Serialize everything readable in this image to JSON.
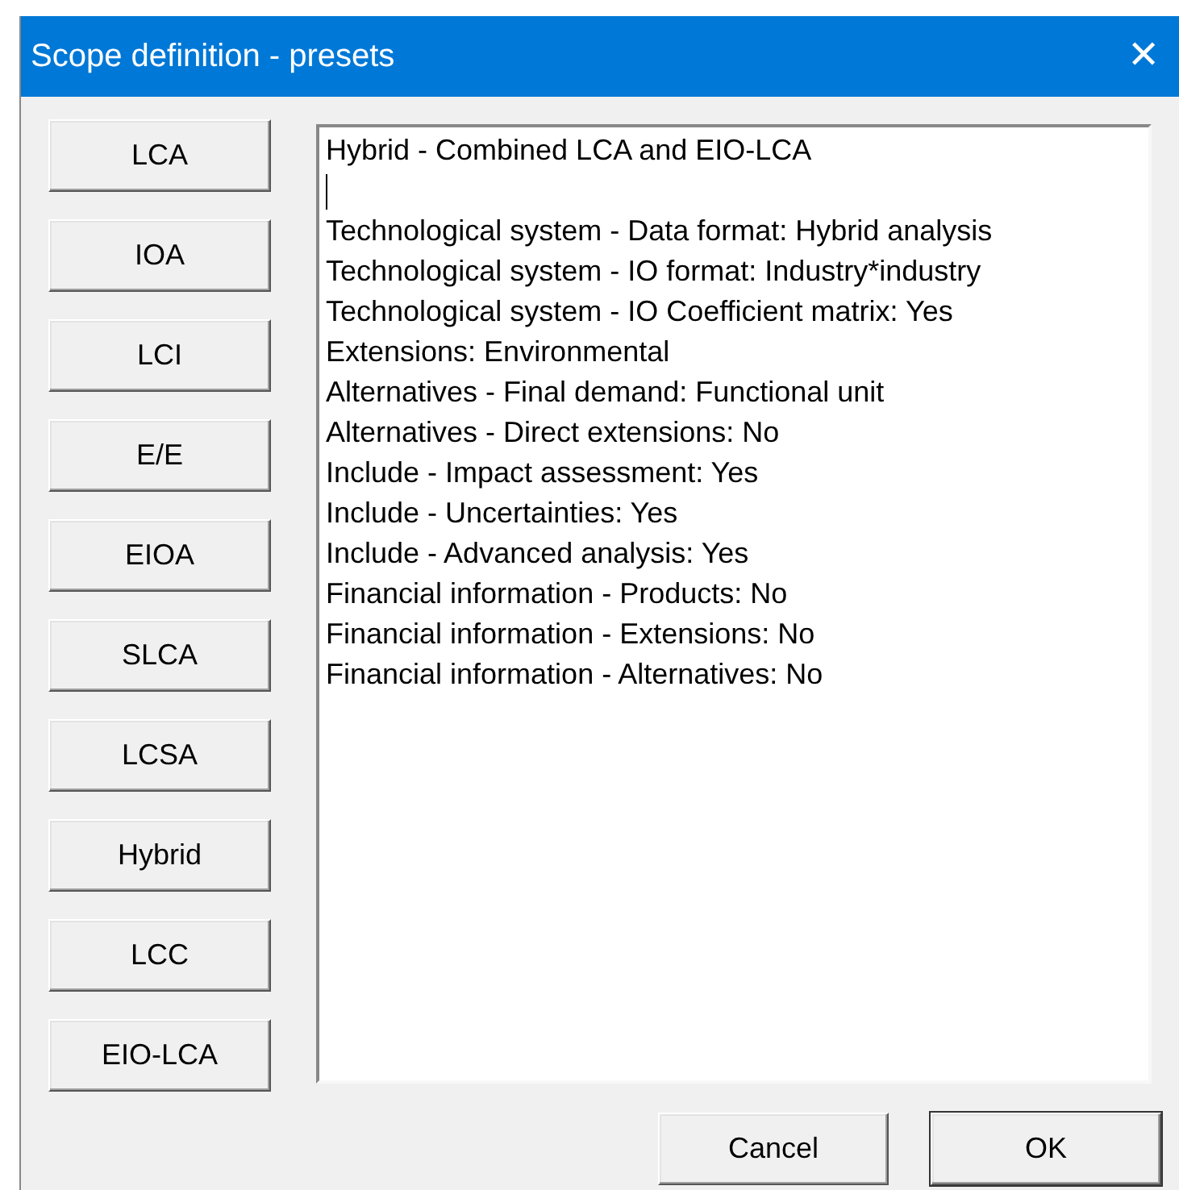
{
  "window": {
    "title": "Scope definition - presets",
    "close": "✕"
  },
  "presets": [
    {
      "label": "LCA"
    },
    {
      "label": "IOA"
    },
    {
      "label": "LCI"
    },
    {
      "label": "E/E"
    },
    {
      "label": "EIOA"
    },
    {
      "label": "SLCA"
    },
    {
      "label": "LCSA"
    },
    {
      "label": "Hybrid"
    },
    {
      "label": "LCC"
    },
    {
      "label": "EIO-LCA"
    }
  ],
  "description": [
    {
      "kind": "text",
      "text": "Hybrid - Combined LCA and EIO-LCA"
    },
    {
      "kind": "caret"
    },
    {
      "kind": "text",
      "text": "Technological system - Data format: Hybrid analysis"
    },
    {
      "kind": "text",
      "text": "Technological system - IO format: Industry*industry"
    },
    {
      "kind": "text",
      "text": "Technological system - IO Coefficient matrix: Yes"
    },
    {
      "kind": "text",
      "text": "Extensions: Environmental"
    },
    {
      "kind": "text",
      "text": "Alternatives - Final demand: Functional unit"
    },
    {
      "kind": "text",
      "text": "Alternatives - Direct extensions: No"
    },
    {
      "kind": "text",
      "text": "Include - Impact assessment: Yes"
    },
    {
      "kind": "text",
      "text": "Include - Uncertainties: Yes"
    },
    {
      "kind": "text",
      "text": "Include - Advanced analysis: Yes"
    },
    {
      "kind": "text",
      "text": "Financial information - Products: No"
    },
    {
      "kind": "text",
      "text": "Financial information - Extensions: No"
    },
    {
      "kind": "text",
      "text": "Financial information - Alternatives: No"
    }
  ],
  "buttons": [
    {
      "label": "Cancel",
      "default": false
    },
    {
      "label": "OK",
      "default": true
    }
  ]
}
